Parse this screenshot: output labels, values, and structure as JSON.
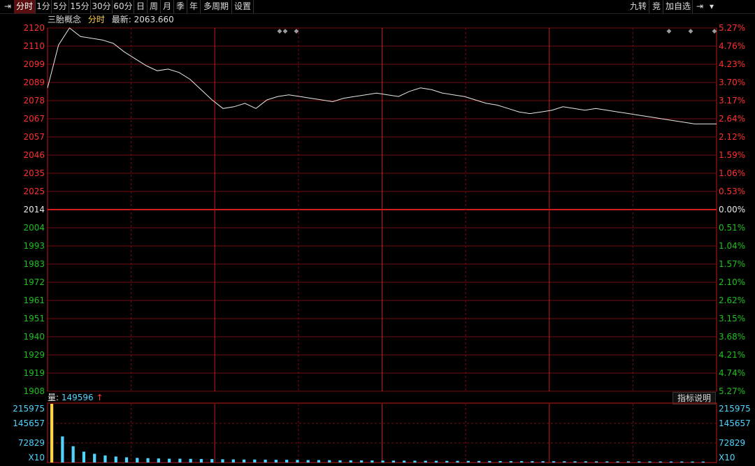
{
  "toolbar": {
    "left_items": [
      {
        "label": "分时",
        "active": true,
        "icon": "pin-left-icon"
      },
      {
        "label": "1分"
      },
      {
        "label": "5分"
      },
      {
        "label": "15分"
      },
      {
        "label": "30分"
      },
      {
        "label": "60分"
      },
      {
        "label": "日"
      },
      {
        "label": "周"
      },
      {
        "label": "月"
      },
      {
        "label": "季"
      },
      {
        "label": "年"
      },
      {
        "label": "多周期"
      },
      {
        "label": "设置"
      }
    ],
    "right_items": [
      {
        "label": "九转"
      },
      {
        "label": "竞"
      },
      {
        "label": "加自选"
      }
    ],
    "right_icons": [
      "pin-right-icon",
      "dropdown-arrow-icon"
    ]
  },
  "info": {
    "name": "三胎概念",
    "period": "分时",
    "latest_label": "最新:",
    "latest_value": "2063.660"
  },
  "price_axis": {
    "left_ticks": [
      "2120",
      "2110",
      "2099",
      "2089",
      "2078",
      "2067",
      "2057",
      "2046",
      "2035",
      "2025",
      "2014",
      "2004",
      "1993",
      "1983",
      "1972",
      "1961",
      "1951",
      "1940",
      "1929",
      "1919",
      "1908"
    ],
    "right_ticks": [
      "5.27%",
      "4.76%",
      "4.23%",
      "3.70%",
      "3.17%",
      "2.64%",
      "2.12%",
      "1.59%",
      "1.06%",
      "0.53%",
      "0.00%",
      "0.51%",
      "1.04%",
      "1.57%",
      "2.10%",
      "2.62%",
      "3.15%",
      "3.68%",
      "4.21%",
      "4.74%",
      "5.27%"
    ],
    "base_index": 10
  },
  "volume": {
    "label": "量:",
    "value": "149596",
    "arrow": "↑",
    "indicator_button": "指标说明",
    "ticks": [
      "215975",
      "145657",
      "72829"
    ],
    "multiplier": "X10"
  },
  "colors": {
    "up": "#ff3030",
    "down": "#1fc01f",
    "neutral": "#e8e8e8",
    "grid": "#7a0d0d",
    "grid_major": "#c01818",
    "line": "#e8e8e8",
    "volume": "#4fd4ff",
    "marker": "#9a9a9a"
  },
  "chart_data": {
    "type": "line",
    "title": "",
    "xlabel": "",
    "ylabel": "",
    "ylim": [
      1908,
      2120
    ],
    "base": 2014,
    "series": [
      {
        "values": [
          2085,
          2110,
          2120,
          2115,
          2114,
          2113,
          2111,
          2106,
          2102,
          2098,
          2095,
          2096,
          2094,
          2090,
          2084,
          2078,
          2073,
          2074,
          2076,
          2073,
          2078,
          2080,
          2081,
          2080,
          2079,
          2078,
          2077,
          2079,
          2080,
          2081,
          2082,
          2081,
          2080,
          2083,
          2085,
          2084,
          2082,
          2081,
          2080,
          2078,
          2076,
          2075,
          2073,
          2071,
          2070,
          2071,
          2072,
          2074,
          2073,
          2072,
          2073,
          2072,
          2071,
          2070,
          2069,
          2068,
          2067,
          2066,
          2065,
          2064,
          2064,
          2064
        ]
      }
    ],
    "volume": [
      215975,
      96000,
      60000,
      40000,
      32000,
      26000,
      22000,
      19000,
      17000,
      16000,
      15000,
      14000,
      14000,
      13500,
      13000,
      12500,
      12000,
      11500,
      11000,
      11000,
      10500,
      10000,
      10000,
      9500,
      9000,
      9000,
      8500,
      8000,
      8000,
      7500,
      7500,
      7000,
      7000,
      6800,
      6600,
      6400,
      6200,
      6000,
      6000,
      5800,
      5600,
      5400,
      5200,
      5000,
      5000,
      4800,
      4600,
      4500,
      4400,
      4300,
      4200,
      4100,
      4000,
      4000,
      3900,
      3800,
      3800,
      3700,
      3600,
      3600,
      3500,
      3500
    ],
    "volume_max": 215975,
    "markers": {
      "group1": [
        "◆",
        "◆",
        "◆"
      ],
      "group2": [
        "◆",
        "◆",
        "◆"
      ]
    }
  }
}
